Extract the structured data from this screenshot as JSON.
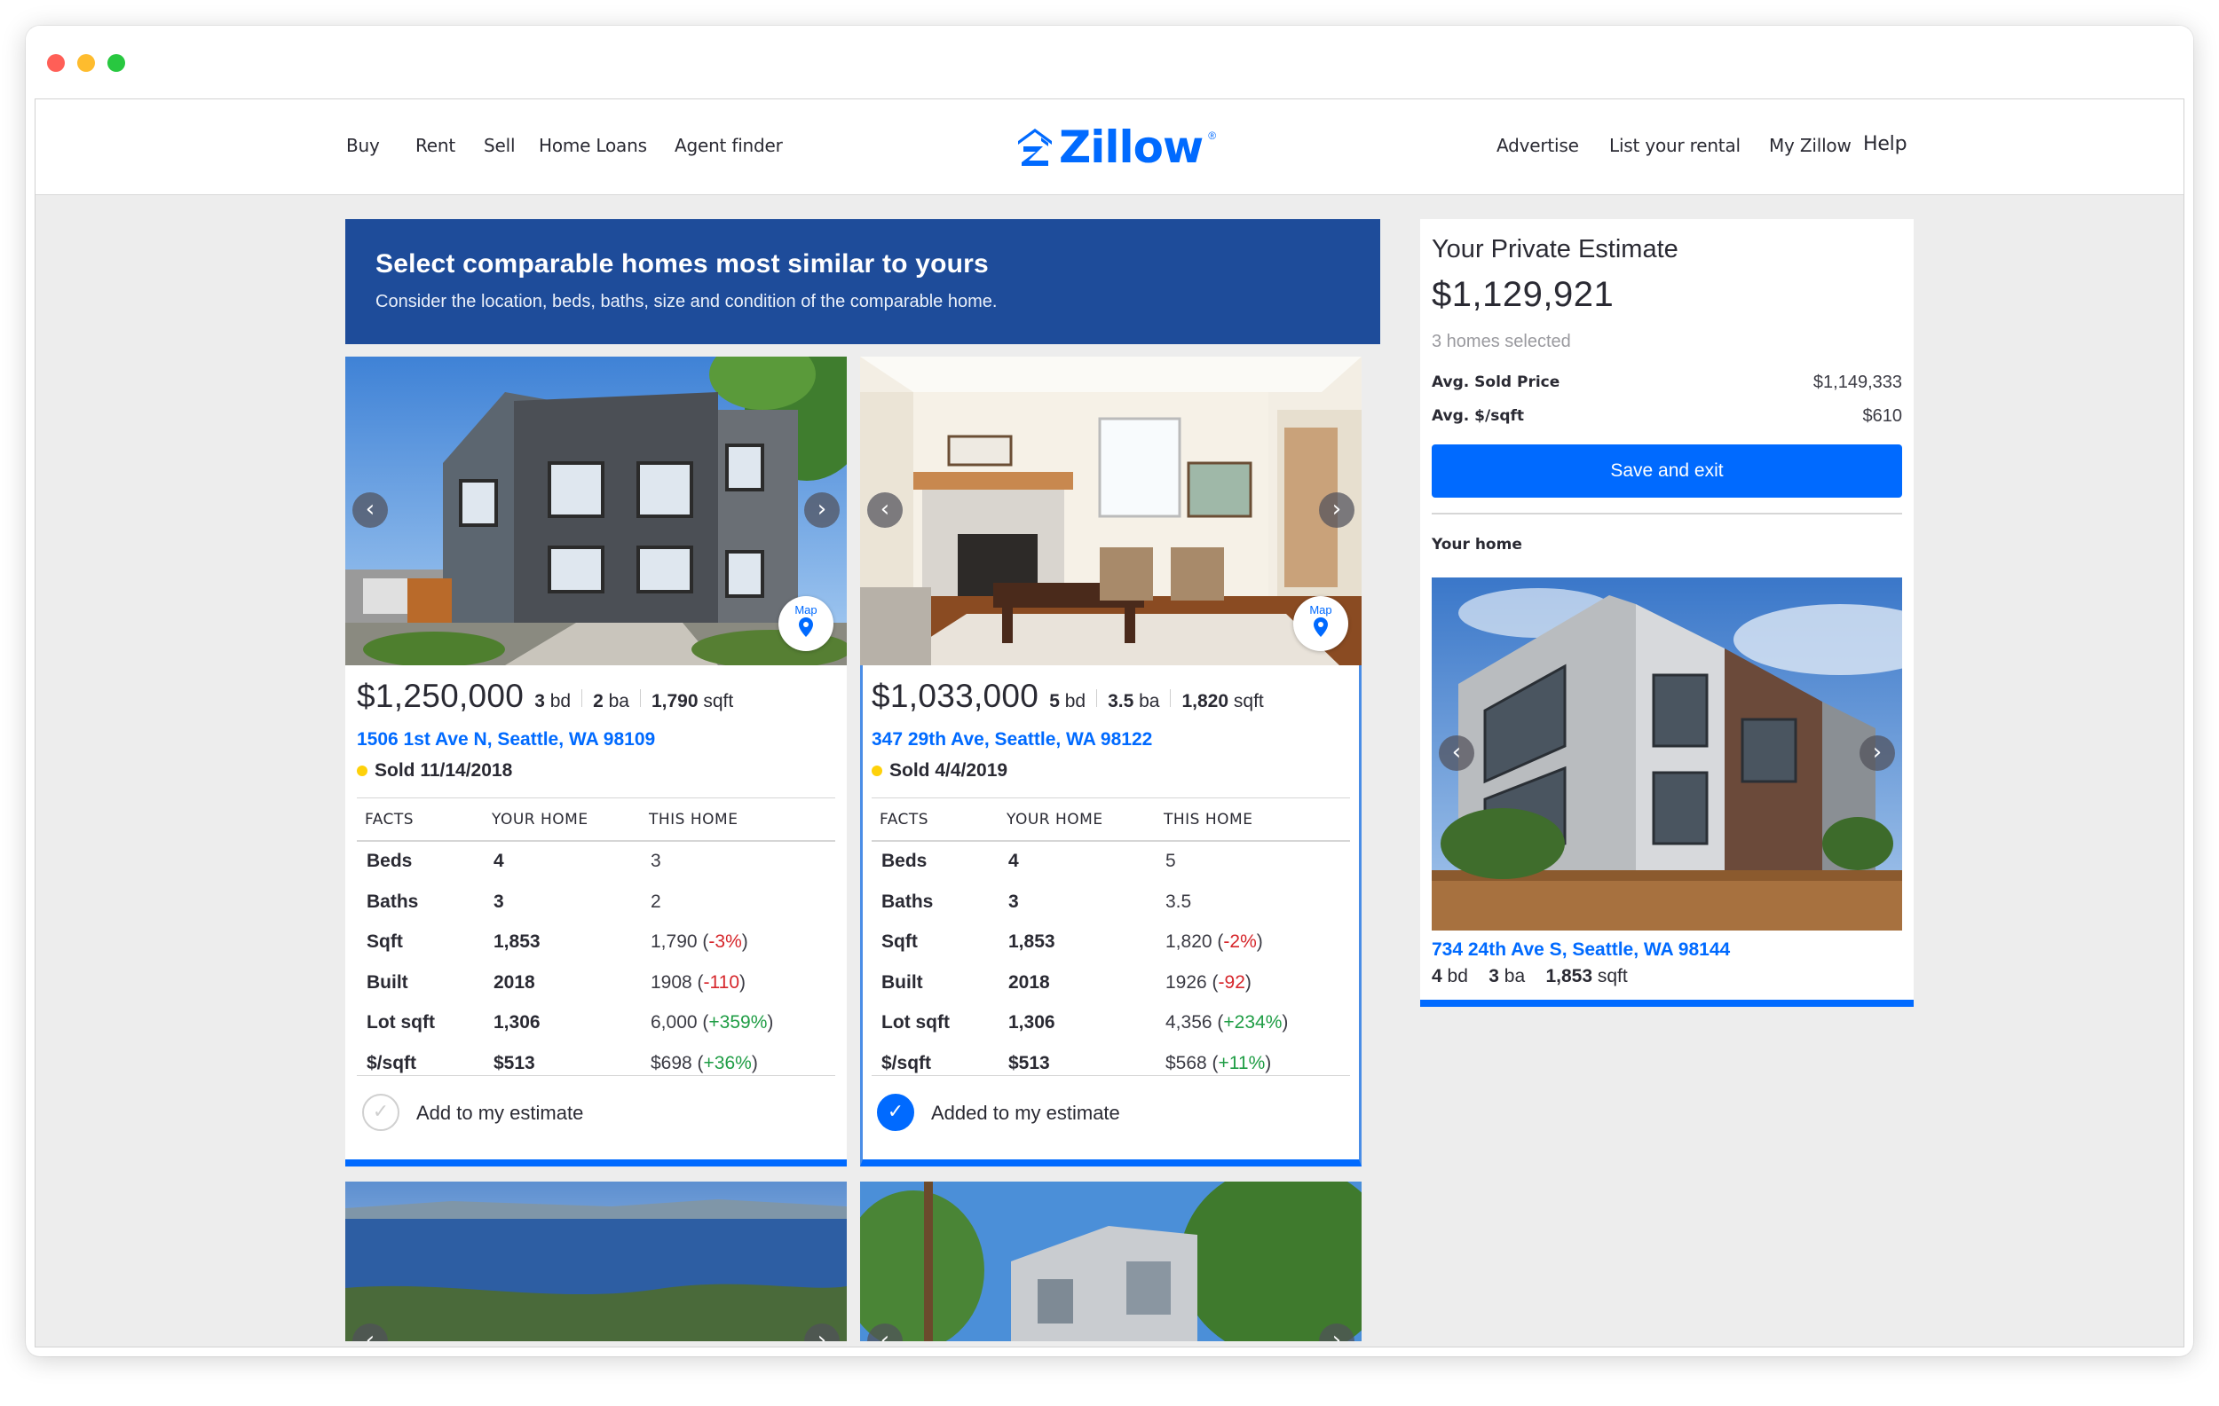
{
  "nav": {
    "left": [
      "Buy",
      "Rent",
      "Sell",
      "Home Loans",
      "Agent finder"
    ],
    "right": [
      "Advertise",
      "List your rental",
      "My Zillow"
    ],
    "help": "Help"
  },
  "logo": {
    "text": "Zillow",
    "trademark": "®"
  },
  "banner": {
    "title": "Select comparable homes most similar to yours",
    "subtitle": "Consider the location, beds, baths, size and condition of the comparable home."
  },
  "facts_headers": {
    "facts": "FACTS",
    "yours": "YOUR HOME",
    "this": "THIS HOME"
  },
  "cards": [
    {
      "price": "$1,250,000",
      "beds": "3",
      "beds_unit": "bd",
      "baths": "2",
      "baths_unit": "ba",
      "sqft": "1,790",
      "sqft_unit": "sqft",
      "address": "1506 1st Ave N, Seattle, WA 98109",
      "sold": "Sold 11/14/2018",
      "facts": [
        {
          "label": "Beds",
          "yours": "4",
          "this": "3",
          "delta": "",
          "delta_type": ""
        },
        {
          "label": "Baths",
          "yours": "3",
          "this": "2",
          "delta": "",
          "delta_type": ""
        },
        {
          "label": "Sqft",
          "yours": "1,853",
          "this": "1,790",
          "delta": "-3%",
          "delta_type": "neg"
        },
        {
          "label": "Built",
          "yours": "2018",
          "this": "1908",
          "delta": "-110",
          "delta_type": "neg"
        },
        {
          "label": "Lot sqft",
          "yours": "1,306",
          "this": "6,000",
          "delta": "+359%",
          "delta_type": "pos"
        },
        {
          "label": "$/sqft",
          "yours": "$513",
          "this": "$698",
          "delta": "+36%",
          "delta_type": "pos"
        }
      ],
      "estimate_label": "Add to my estimate",
      "selected": false,
      "map_label": "Map"
    },
    {
      "price": "$1,033,000",
      "beds": "5",
      "beds_unit": "bd",
      "baths": "3.5",
      "baths_unit": "ba",
      "sqft": "1,820",
      "sqft_unit": "sqft",
      "address": "347 29th Ave, Seattle, WA 98122",
      "sold": "Sold 4/4/2019",
      "facts": [
        {
          "label": "Beds",
          "yours": "4",
          "this": "5",
          "delta": "",
          "delta_type": ""
        },
        {
          "label": "Baths",
          "yours": "3",
          "this": "3.5",
          "delta": "",
          "delta_type": ""
        },
        {
          "label": "Sqft",
          "yours": "1,853",
          "this": "1,820",
          "delta": "-2%",
          "delta_type": "neg"
        },
        {
          "label": "Built",
          "yours": "2018",
          "this": "1926",
          "delta": "-92",
          "delta_type": "neg"
        },
        {
          "label": "Lot sqft",
          "yours": "1,306",
          "this": "4,356",
          "delta": "+234%",
          "delta_type": "pos"
        },
        {
          "label": "$/sqft",
          "yours": "$513",
          "this": "$568",
          "delta": "+11%",
          "delta_type": "pos"
        }
      ],
      "estimate_label": "Added to my estimate",
      "selected": true,
      "map_label": "Map"
    }
  ],
  "panel": {
    "title": "Your Private Estimate",
    "price": "$1,129,921",
    "selected_count": "3 homes selected",
    "avg_sold_label": "Avg. Sold Price",
    "avg_sold_value": "$1,149,333",
    "avg_sqft_label": "Avg. $/sqft",
    "avg_sqft_value": "$610",
    "save_label": "Save and exit",
    "your_home_label": "Your home",
    "address": "734 24th Ave S, Seattle, WA 98144",
    "beds": "4",
    "beds_unit": "bd",
    "baths": "3",
    "baths_unit": "ba",
    "sqft": "1,853",
    "sqft_unit": "sqft"
  },
  "colors": {
    "brand_blue": "#006aff",
    "banner_blue": "#1e4c9a",
    "negative": "#d6262b",
    "positive": "#1f9d45",
    "sold_dot": "#fed10a"
  },
  "icons": {
    "carousel_prev": "chevron-left-icon",
    "carousel_next": "chevron-right-icon",
    "map": "map-pin-icon",
    "check": "check-icon"
  }
}
